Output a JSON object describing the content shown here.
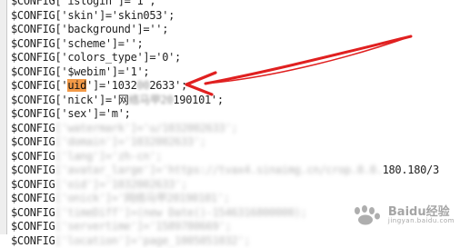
{
  "editor": {
    "lines": [
      {
        "pre": "$CONFIG['islogin']='1';"
      },
      {
        "pre": "$CONFIG['skin']='skin053';"
      },
      {
        "pre": "$CONFIG['background']='';"
      },
      {
        "pre": "$CONFIG['scheme']='';"
      },
      {
        "pre": "$CONFIG['colors_type']='0';"
      },
      {
        "pre": "$CONFIG['$webim']='1';"
      },
      {
        "pre": "$CONFIG['",
        "hl": "uid",
        "mid": "']='1032",
        "blur": "00",
        "post": "2633';"
      },
      {
        "pre": "$CONFIG['nick']='网",
        "blur": "络马甲20",
        "post": "190101';"
      },
      {
        "pre": "$CONFIG['sex']='m';"
      },
      {
        "pre": "$CONFIG",
        "blur": "['watermark']='u/1032002633';"
      },
      {
        "pre": "$CONFIG",
        "blur": "['domain']='1032002633';"
      },
      {
        "pre": "$CONFIG",
        "blur": "['lang']='zh-cn';"
      },
      {
        "pre": "$CONFIG",
        "blur": "['avatar_large']='https://tvax4.sinaimg.cn/crop.0.0.",
        "post": "180.180/3"
      },
      {
        "pre": "$CONFIG",
        "blur": "['oid']='1032002633';"
      },
      {
        "pre": "$CONFIG",
        "blur": "['onick']='网络马甲20190101';"
      },
      {
        "pre": "$CONFIG",
        "blur": "['timeDiff']=(new Date()-1546316800000);"
      },
      {
        "pre": "$CONFIG",
        "blur": "['servertime']='1589780669';"
      },
      {
        "pre": "$CONFIG",
        "blur": "['location']='page_1005051032';"
      }
    ]
  },
  "watermark": {
    "brand": "Baidu经验",
    "subtitle": "jingyan.baidu.com"
  },
  "colors": {
    "highlight": "#f39a47",
    "arrow": "#e02020"
  }
}
